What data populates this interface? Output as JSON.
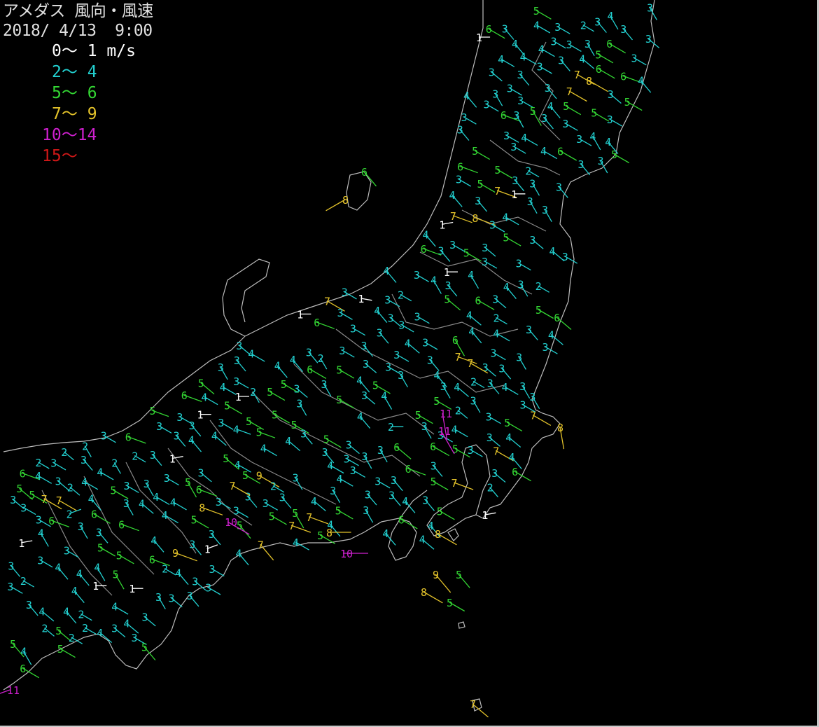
{
  "header": {
    "title": "アメダス 風向・風速",
    "datetime": "2018/ 4/13  9:00"
  },
  "legend": [
    {
      "label": "0〜 1 m/s",
      "color": "#ffffff"
    },
    {
      "label": "2〜 4",
      "color": "#22d0d0"
    },
    {
      "label": "5〜 6",
      "color": "#33d633"
    },
    {
      "label": "7〜 9",
      "color": "#e3c22a"
    },
    {
      "label": "10〜14",
      "color": "#d020d0"
    },
    {
      "label": "15〜",
      "color": "#d01818"
    }
  ],
  "colors": {
    "background": "#000000",
    "coastline": "#bdbdbd",
    "calm": "#ffffff",
    "light": "#22d0d0",
    "moderate": "#33d633",
    "fresh": "#e3c22a",
    "strong": "#d020d0",
    "gale": "#d01818"
  },
  "stations": [
    {
      "s": 2,
      "d": 270
    },
    {
      "s": 3,
      "d": 300
    },
    {
      "s": 4,
      "d": 290
    },
    {
      "s": 5,
      "d": 300
    },
    {
      "s": 3,
      "d": 320
    },
    {
      "s": 4,
      "d": 300
    },
    {
      "s": 2,
      "d": 250
    },
    {
      "s": 6,
      "d": 300
    },
    {
      "s": 3,
      "d": 310
    },
    {
      "s": 4,
      "d": 300
    },
    {
      "s": 5,
      "d": 290
    },
    {
      "s": 3,
      "d": 330
    },
    {
      "s": 6,
      "d": 300
    },
    {
      "s": 4,
      "d": 320
    },
    {
      "s": 3,
      "d": 300
    },
    {
      "s": 5,
      "d": 310
    },
    {
      "s": 9,
      "d": 290
    },
    {
      "s": 7,
      "d": 300
    },
    {
      "s": 8,
      "d": 300
    },
    {
      "s": 3,
      "d": 320
    },
    {
      "s": 5,
      "d": 300
    },
    {
      "s": 3,
      "d": 300
    },
    {
      "s": 6,
      "d": 290
    },
    {
      "s": 5,
      "d": 300
    },
    {
      "s": 3,
      "d": 310
    },
    {
      "s": 7,
      "d": 300
    },
    {
      "s": 6,
      "d": 290
    },
    {
      "s": 1,
      "d": 250
    },
    {
      "s": 3,
      "d": 300
    },
    {
      "s": 4,
      "d": 330
    },
    {
      "s": 5,
      "d": 300
    },
    {
      "s": 3,
      "d": 320
    },
    {
      "s": 7,
      "d": 300
    },
    {
      "s": 5,
      "d": 300
    },
    {
      "s": 3,
      "d": 300
    },
    {
      "s": 4,
      "d": 310
    },
    {
      "s": 1,
      "d": 270
    },
    {
      "s": 3,
      "d": 330
    },
    {
      "s": 3,
      "d": 300
    },
    {
      "s": 6,
      "d": 300
    },
    {
      "s": 6,
      "d": 290
    },
    {
      "s": 9,
      "d": 300
    },
    {
      "s": 3,
      "d": 320
    },
    {
      "s": 6,
      "d": 290
    },
    {
      "s": 4,
      "d": 300
    },
    {
      "s": 3,
      "d": 320
    },
    {
      "s": 3,
      "d": 300
    },
    {
      "s": 5,
      "d": 310
    },
    {
      "s": 8,
      "d": 290
    },
    {
      "s": 5,
      "d": 300
    },
    {
      "s": 4,
      "d": 320
    },
    {
      "s": 3,
      "d": 300
    },
    {
      "s": 1,
      "d": 270
    },
    {
      "s": 3,
      "d": 320
    },
    {
      "s": 4,
      "d": 330
    },
    {
      "s": 5,
      "d": 300
    },
    {
      "s": 7,
      "d": 300
    },
    {
      "s": 4,
      "d": 300
    },
    {
      "s": 3,
      "d": 330
    },
    {
      "s": 3,
      "d": 320
    },
    {
      "s": 3,
      "d": 310
    },
    {
      "s": 5,
      "d": 300
    },
    {
      "s": 3,
      "d": 300
    },
    {
      "s": 6,
      "d": 290
    },
    {
      "s": 4,
      "d": 310
    },
    {
      "s": 1,
      "d": 270
    },
    {
      "s": 3,
      "d": 320
    },
    {
      "s": 3,
      "d": 300
    },
    {
      "s": 5,
      "d": 300
    },
    {
      "s": 6,
      "d": 290
    },
    {
      "s": 3,
      "d": 320
    },
    {
      "s": 2,
      "d": 300
    },
    {
      "s": 4,
      "d": 330
    },
    {
      "s": 5,
      "d": 300
    },
    {
      "s": 3,
      "d": 300
    },
    {
      "s": 7,
      "d": 290
    },
    {
      "s": 4,
      "d": 320
    },
    {
      "s": 3,
      "d": 300
    },
    {
      "s": 3,
      "d": 330
    },
    {
      "s": 5,
      "d": 300
    },
    {
      "s": 8,
      "d": 290
    },
    {
      "s": 3,
      "d": 310
    },
    {
      "s": 4,
      "d": 320
    },
    {
      "s": 3,
      "d": 300
    },
    {
      "s": 2,
      "d": 310
    },
    {
      "s": 6,
      "d": 300
    },
    {
      "s": 3,
      "d": 320
    },
    {
      "s": 4,
      "d": 300
    },
    {
      "s": 3,
      "d": 320
    },
    {
      "s": 5,
      "d": 300
    },
    {
      "s": 3,
      "d": 310
    },
    {
      "s": 1,
      "d": 280
    },
    {
      "s": 4,
      "d": 320
    },
    {
      "s": 3,
      "d": 300
    },
    {
      "s": 2,
      "d": 330
    },
    {
      "s": 5,
      "d": 300
    },
    {
      "s": 3,
      "d": 300
    },
    {
      "s": 4,
      "d": 320
    },
    {
      "s": 3,
      "d": 320
    },
    {
      "s": 7,
      "d": 290
    },
    {
      "s": 3,
      "d": 300
    },
    {
      "s": 5,
      "d": 300
    },
    {
      "s": 4,
      "d": 310
    },
    {
      "s": 3,
      "d": 330
    },
    {
      "s": 6,
      "d": 300
    },
    {
      "s": 3,
      "d": 300
    },
    {
      "s": 3,
      "d": 320
    },
    {
      "s": 2,
      "d": 300
    },
    {
      "s": 4,
      "d": 310
    },
    {
      "s": 3,
      "d": 330
    },
    {
      "s": 5,
      "d": 300
    },
    {
      "s": 3,
      "d": 300
    },
    {
      "s": 7,
      "d": 290
    },
    {
      "s": 4,
      "d": 320
    },
    {
      "s": 1,
      "d": 270
    },
    {
      "s": 3,
      "d": 300
    },
    {
      "s": 3,
      "d": 330
    },
    {
      "s": 5,
      "d": 300
    },
    {
      "s": 4,
      "d": 310
    },
    {
      "s": 3,
      "d": 320
    },
    {
      "s": 2,
      "d": 300
    },
    {
      "s": 6,
      "d": 290
    },
    {
      "s": 3,
      "d": 320
    },
    {
      "s": 4,
      "d": 300
    },
    {
      "s": 3,
      "d": 310
    },
    {
      "s": 5,
      "d": 300
    },
    {
      "s": 3,
      "d": 330
    },
    {
      "s": 7,
      "d": 300
    },
    {
      "s": 4,
      "d": 320
    },
    {
      "s": 3,
      "d": 300
    },
    {
      "s": 1,
      "d": 260
    },
    {
      "s": 3,
      "d": 320
    },
    {
      "s": 4,
      "d": 300
    },
    {
      "s": 5,
      "d": 310
    },
    {
      "s": 3,
      "d": 330
    },
    {
      "s": 2,
      "d": 300
    },
    {
      "s": 3,
      "d": 320
    },
    {
      "s": 4,
      "d": 310
    },
    {
      "s": 6,
      "d": 300
    },
    {
      "s": 3,
      "d": 300
    },
    {
      "s": 5,
      "d": 290
    },
    {
      "s": 4,
      "d": 320
    },
    {
      "s": 3,
      "d": 300
    },
    {
      "s": 3,
      "d": 330
    },
    {
      "s": 7,
      "d": 300
    },
    {
      "s": 3,
      "d": 320
    },
    {
      "s": 4,
      "d": 300
    },
    {
      "s": 5,
      "d": 300
    },
    {
      "s": 3,
      "d": 310
    },
    {
      "s": 2,
      "d": 330
    },
    {
      "s": 4,
      "d": 300
    },
    {
      "s": 3,
      "d": 320
    },
    {
      "s": 3,
      "d": 300
    },
    {
      "s": 6,
      "d": 290
    },
    {
      "s": 4,
      "d": 320
    },
    {
      "s": 3,
      "d": 300
    },
    {
      "s": 5,
      "d": 300
    },
    {
      "s": 3,
      "d": 330
    },
    {
      "s": 4,
      "d": 310
    },
    {
      "s": 1,
      "d": 260
    },
    {
      "s": 3,
      "d": 300
    },
    {
      "s": 4,
      "d": 320
    },
    {
      "s": 3,
      "d": 320
    },
    {
      "s": 5,
      "d": 300
    },
    {
      "s": 2,
      "d": 300
    },
    {
      "s": 3,
      "d": 330
    },
    {
      "s": 4,
      "d": 300
    },
    {
      "s": 3,
      "d": 310
    },
    {
      "s": 6,
      "d": 290
    },
    {
      "s": 3,
      "d": 320
    },
    {
      "s": 4,
      "d": 300
    },
    {
      "s": 3,
      "d": 300
    },
    {
      "s": 5,
      "d": 310
    },
    {
      "s": 3,
      "d": 330
    },
    {
      "s": 7,
      "d": 290
    },
    {
      "s": 4,
      "d": 320
    },
    {
      "s": 3,
      "d": 300
    },
    {
      "s": 2,
      "d": 300
    },
    {
      "s": 3,
      "d": 320
    },
    {
      "s": 4,
      "d": 310
    },
    {
      "s": 5,
      "d": 300
    },
    {
      "s": 3,
      "d": 330
    },
    {
      "s": 3,
      "d": 300
    },
    {
      "s": 4,
      "d": 320
    },
    {
      "s": 6,
      "d": 300
    },
    {
      "s": 3,
      "d": 310
    },
    {
      "s": 1,
      "d": 270
    },
    {
      "s": 4,
      "d": 300
    },
    {
      "s": 3,
      "d": 320
    },
    {
      "s": 5,
      "d": 300
    },
    {
      "s": 3,
      "d": 330
    },
    {
      "s": 2,
      "d": 300
    },
    {
      "s": 4,
      "d": 320
    },
    {
      "s": 3,
      "d": 300
    },
    {
      "s": 3,
      "d": 310
    },
    {
      "s": 5,
      "d": 300
    },
    {
      "s": 4,
      "d": 330
    },
    {
      "s": 3,
      "d": 300
    },
    {
      "s": 6,
      "d": 290
    },
    {
      "s": 3,
      "d": 320
    },
    {
      "s": 4,
      "d": 300
    },
    {
      "s": 3,
      "d": 300
    },
    {
      "s": 2,
      "d": 320
    },
    {
      "s": 5,
      "d": 310
    },
    {
      "s": 3,
      "d": 330
    },
    {
      "s": 4,
      "d": 300
    },
    {
      "s": 3,
      "d": 320
    },
    {
      "s": 7,
      "d": 290
    },
    {
      "s": 3,
      "d": 300
    },
    {
      "s": 4,
      "d": 310
    },
    {
      "s": 5,
      "d": 300
    },
    {
      "s": 3,
      "d": 330
    },
    {
      "s": 3,
      "d": 320
    },
    {
      "s": 4,
      "d": 300
    },
    {
      "s": 6,
      "d": 300
    },
    {
      "s": 2,
      "d": 310
    },
    {
      "s": 3,
      "d": 320
    },
    {
      "s": 4,
      "d": 300
    },
    {
      "s": 3,
      "d": 300
    },
    {
      "s": 5,
      "d": 330
    },
    {
      "s": 3,
      "d": 320
    },
    {
      "s": 1,
      "d": 260
    },
    {
      "s": 4,
      "d": 300
    },
    {
      "s": 3,
      "d": 310
    },
    {
      "s": 3,
      "d": 300
    },
    {
      "s": 5,
      "d": 320
    },
    {
      "s": 4,
      "d": 300
    },
    {
      "s": 3,
      "d": 330
    },
    {
      "s": 6,
      "d": 290
    },
    {
      "s": 3,
      "d": 300
    },
    {
      "s": 4,
      "d": 320
    },
    {
      "s": 2,
      "d": 300
    },
    {
      "s": 3,
      "d": 310
    },
    {
      "s": 5,
      "d": 300
    },
    {
      "s": 3,
      "d": 330
    },
    {
      "s": 4,
      "d": 320
    },
    {
      "s": 3,
      "d": 300
    },
    {
      "s": 7,
      "d": 300
    },
    {
      "s": 3,
      "d": 320
    },
    {
      "s": 4,
      "d": 310
    },
    {
      "s": 5,
      "d": 300
    },
    {
      "s": 3,
      "d": 300
    },
    {
      "s": 2,
      "d": 330
    },
    {
      "s": 4,
      "d": 320
    },
    {
      "s": 3,
      "d": 300
    },
    {
      "s": 3,
      "d": 310
    },
    {
      "s": 6,
      "d": 300
    },
    {
      "s": 4,
      "d": 320
    },
    {
      "s": 3,
      "d": 300
    },
    {
      "s": 5,
      "d": 330
    },
    {
      "s": 3,
      "d": 300
    },
    {
      "s": 4,
      "d": 310
    },
    {
      "s": 1,
      "d": 270
    },
    {
      "s": 3,
      "d": 320
    },
    {
      "s": 3,
      "d": 300
    },
    {
      "s": 5,
      "d": 300
    },
    {
      "s": 4,
      "d": 330
    },
    {
      "s": 3,
      "d": 320
    },
    {
      "s": 2,
      "d": 300
    },
    {
      "s": 6,
      "d": 290
    },
    {
      "s": 3,
      "d": 310
    },
    {
      "s": 4,
      "d": 300
    },
    {
      "s": 3,
      "d": 320
    },
    {
      "s": 5,
      "d": 300
    },
    {
      "s": 3,
      "d": 330
    },
    {
      "s": 4,
      "d": 300
    },
    {
      "s": 7,
      "d": 290
    },
    {
      "s": 3,
      "d": 320
    },
    {
      "s": 4,
      "d": 310
    },
    {
      "s": 3,
      "d": 300
    },
    {
      "s": 5,
      "d": 300
    },
    {
      "s": 2,
      "d": 330
    },
    {
      "s": 3,
      "d": 320
    },
    {
      "s": 4,
      "d": 300
    },
    {
      "s": 3,
      "d": 310
    },
    {
      "s": 6,
      "d": 300
    },
    {
      "s": 4,
      "d": 320
    },
    {
      "s": 3,
      "d": 300
    },
    {
      "s": 3,
      "d": 330
    },
    {
      "s": 5,
      "d": 300
    },
    {
      "s": 4,
      "d": 320
    },
    {
      "s": 3,
      "d": 310
    },
    {
      "s": 2,
      "d": 300
    },
    {
      "s": 3,
      "d": 300
    },
    {
      "s": 5,
      "d": 320
    },
    {
      "s": 4,
      "d": 330
    },
    {
      "s": 3,
      "d": 300
    },
    {
      "s": 1,
      "d": 270
    },
    {
      "s": 3,
      "d": 320
    },
    {
      "s": 4,
      "d": 300
    },
    {
      "s": 6,
      "d": 290
    },
    {
      "s": 3,
      "d": 310
    },
    {
      "s": 5,
      "d": 300
    },
    {
      "s": 3,
      "d": 330
    },
    {
      "s": 4,
      "d": 320
    },
    {
      "s": 3,
      "d": 300
    },
    {
      "s": 2,
      "d": 300
    },
    {
      "s": 4,
      "d": 310
    },
    {
      "s": 3,
      "d": 320
    },
    {
      "s": 5,
      "d": 300
    },
    {
      "s": 3,
      "d": 330
    },
    {
      "s": 7,
      "d": 300
    },
    {
      "s": 4,
      "d": 320
    },
    {
      "s": 3,
      "d": 300
    },
    {
      "s": 3,
      "d": 310
    },
    {
      "s": 5,
      "d": 300
    },
    {
      "s": 4,
      "d": 330
    },
    {
      "s": 3,
      "d": 320
    },
    {
      "s": 6,
      "d": 300
    },
    {
      "s": 2,
      "d": 300
    },
    {
      "s": 3,
      "d": 310
    },
    {
      "s": 4,
      "d": 320
    },
    {
      "s": 3,
      "d": 300
    },
    {
      "s": 5,
      "d": 330
    },
    {
      "s": 3,
      "d": 300
    },
    {
      "s": 4,
      "d": 320
    },
    {
      "s": 1,
      "d": 260
    },
    {
      "s": 3,
      "d": 310
    },
    {
      "s": 3,
      "d": 300
    },
    {
      "s": 5,
      "d": 300
    },
    {
      "s": 4,
      "d": 320
    },
    {
      "s": 3,
      "d": 330
    },
    {
      "s": 2,
      "d": 300
    },
    {
      "s": 6,
      "d": 310
    },
    {
      "s": 3,
      "d": 320
    },
    {
      "s": 4,
      "d": 300
    },
    {
      "s": 3,
      "d": 300
    },
    {
      "s": 5,
      "d": 330
    },
    {
      "s": 3,
      "d": 320
    },
    {
      "s": 4,
      "d": 310
    },
    {
      "s": 7,
      "d": 300
    },
    {
      "s": 3,
      "d": 300
    },
    {
      "s": 4,
      "d": 320
    },
    {
      "s": 3,
      "d": 330
    },
    {
      "s": 5,
      "d": 300
    },
    {
      "s": 2,
      "d": 310
    },
    {
      "s": 3,
      "d": 320
    },
    {
      "s": 4,
      "d": 300
    },
    {
      "s": 3,
      "d": 300
    },
    {
      "s": 6,
      "d": 330
    },
    {
      "s": 4,
      "d": 320
    },
    {
      "s": 3,
      "d": 310
    },
    {
      "s": 3,
      "d": 300
    },
    {
      "s": 5,
      "d": 300
    },
    {
      "s": 4,
      "d": 320
    },
    {
      "s": 3,
      "d": 330
    },
    {
      "s": 2,
      "d": 300
    },
    {
      "s": 3,
      "d": 310
    },
    {
      "s": 5,
      "d": 320
    },
    {
      "s": 4,
      "d": 300
    },
    {
      "s": 3,
      "d": 300
    },
    {
      "s": 1,
      "d": 270
    },
    {
      "s": 3,
      "d": 330
    },
    {
      "s": 4,
      "d": 320
    },
    {
      "s": 6,
      "d": 310
    },
    {
      "s": 3,
      "d": 300
    },
    {
      "s": 5,
      "d": 300
    },
    {
      "s": 3,
      "d": 320
    },
    {
      "s": 4,
      "d": 330
    },
    {
      "s": 3,
      "d": 300
    },
    {
      "s": 2,
      "d": 310
    },
    {
      "s": 4,
      "d": 320
    },
    {
      "s": 3,
      "d": 300
    },
    {
      "s": 5,
      "d": 300
    },
    {
      "s": 3,
      "d": 330
    },
    {
      "s": 7,
      "d": 320
    },
    {
      "s": 4,
      "d": 310
    },
    {
      "s": 3,
      "d": 300
    },
    {
      "s": 11,
      "d": 350
    },
    {
      "s": 11,
      "d": 330
    },
    {
      "s": 10,
      "d": 300
    },
    {
      "s": 11,
      "d": 70
    },
    {
      "s": 10,
      "d": 270
    },
    {
      "s": 8,
      "d": 270
    },
    {
      "s": 8,
      "d": 300
    },
    {
      "s": 9,
      "d": 320
    },
    {
      "s": 8,
      "d": 350
    },
    {
      "s": 8,
      "d": 300
    },
    {
      "s": 5,
      "d": 300
    },
    {
      "s": 6,
      "d": 320
    },
    {
      "s": 8,
      "d": 60
    },
    {
      "s": 7,
      "d": 310
    },
    {
      "s": 5,
      "d": 320
    }
  ]
}
